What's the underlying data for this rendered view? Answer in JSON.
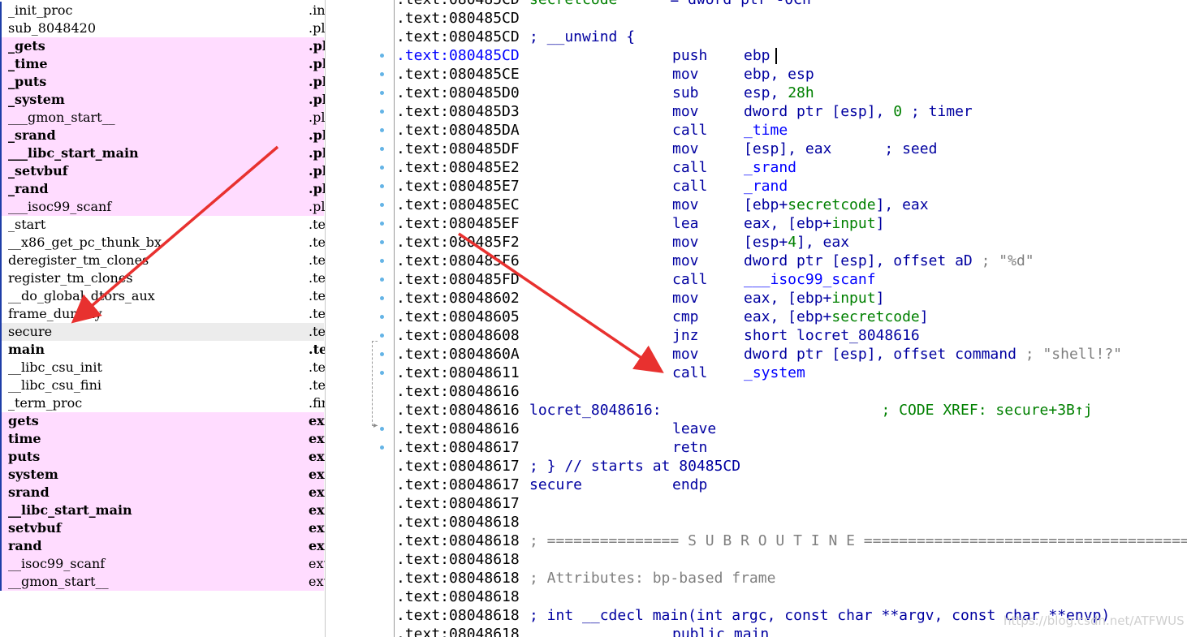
{
  "functions": [
    {
      "name": "_init_proc",
      "seg": ".ini",
      "lib": false,
      "bold": false,
      "sel": false
    },
    {
      "name": "sub_8048420",
      "seg": ".plt",
      "lib": false,
      "bold": false,
      "sel": false
    },
    {
      "name": "_gets",
      "seg": ".plt",
      "lib": true,
      "bold": true,
      "sel": false
    },
    {
      "name": "_time",
      "seg": ".plt",
      "lib": true,
      "bold": true,
      "sel": false
    },
    {
      "name": "_puts",
      "seg": ".plt",
      "lib": true,
      "bold": true,
      "sel": false
    },
    {
      "name": "_system",
      "seg": ".plt",
      "lib": true,
      "bold": true,
      "sel": false
    },
    {
      "name": "___gmon_start__",
      "seg": ".plt",
      "lib": true,
      "bold": false,
      "sel": false
    },
    {
      "name": "_srand",
      "seg": ".plt",
      "lib": true,
      "bold": true,
      "sel": false
    },
    {
      "name": "___libc_start_main",
      "seg": ".plt",
      "lib": true,
      "bold": true,
      "sel": false
    },
    {
      "name": "_setvbuf",
      "seg": ".plt",
      "lib": true,
      "bold": true,
      "sel": false
    },
    {
      "name": "_rand",
      "seg": ".plt",
      "lib": true,
      "bold": true,
      "sel": false
    },
    {
      "name": "___isoc99_scanf",
      "seg": ".plt",
      "lib": true,
      "bold": false,
      "sel": false
    },
    {
      "name": "_start",
      "seg": ".text",
      "lib": false,
      "bold": false,
      "sel": false
    },
    {
      "name": "__x86_get_pc_thunk_bx",
      "seg": ".text",
      "lib": false,
      "bold": false,
      "sel": false
    },
    {
      "name": "deregister_tm_clones",
      "seg": ".text",
      "lib": false,
      "bold": false,
      "sel": false
    },
    {
      "name": "register_tm_clones",
      "seg": ".text",
      "lib": false,
      "bold": false,
      "sel": false
    },
    {
      "name": "__do_global_dtors_aux",
      "seg": ".text",
      "lib": false,
      "bold": false,
      "sel": false
    },
    {
      "name": "frame_dummy",
      "seg": ".text",
      "lib": false,
      "bold": false,
      "sel": false
    },
    {
      "name": "secure",
      "seg": ".text",
      "lib": false,
      "bold": false,
      "sel": true
    },
    {
      "name": "main",
      "seg": ".text",
      "lib": false,
      "bold": true,
      "sel": false
    },
    {
      "name": "__libc_csu_init",
      "seg": ".text",
      "lib": false,
      "bold": false,
      "sel": false
    },
    {
      "name": "__libc_csu_fini",
      "seg": ".text",
      "lib": false,
      "bold": false,
      "sel": false
    },
    {
      "name": "_term_proc",
      "seg": ".fini",
      "lib": false,
      "bold": false,
      "sel": false
    },
    {
      "name": "gets",
      "seg": "extern",
      "lib": true,
      "bold": true,
      "sel": false
    },
    {
      "name": "time",
      "seg": "extern",
      "lib": true,
      "bold": true,
      "sel": false
    },
    {
      "name": "puts",
      "seg": "extern",
      "lib": true,
      "bold": true,
      "sel": false
    },
    {
      "name": "system",
      "seg": "extern",
      "lib": true,
      "bold": true,
      "sel": false
    },
    {
      "name": "srand",
      "seg": "extern",
      "lib": true,
      "bold": true,
      "sel": false
    },
    {
      "name": "__libc_start_main",
      "seg": "extern",
      "lib": true,
      "bold": true,
      "sel": false
    },
    {
      "name": "setvbuf",
      "seg": "extern",
      "lib": true,
      "bold": true,
      "sel": false
    },
    {
      "name": "rand",
      "seg": "extern",
      "lib": true,
      "bold": true,
      "sel": false
    },
    {
      "name": "__isoc99_scanf",
      "seg": "extern",
      "lib": true,
      "bold": false,
      "sel": false
    },
    {
      "name": "__gmon_start__",
      "seg": "extern",
      "lib": true,
      "bold": false,
      "sel": false
    }
  ],
  "disasm": [
    {
      "addr": ".text:080485CD",
      "label": [
        {
          "t": "secretcode",
          "c": "grn"
        },
        {
          "t": "      = dword ptr -0Ch",
          "c": "navy"
        }
      ]
    },
    {
      "addr": ".text:080485CD"
    },
    {
      "addr": ".text:080485CD",
      "label": [
        {
          "t": "; __unwind {",
          "c": "navy"
        }
      ]
    },
    {
      "addr": ".text:080485CD",
      "cur": true,
      "mn": "push",
      "op": [
        {
          "t": "ebp",
          "c": "navy"
        }
      ],
      "cursor": true
    },
    {
      "addr": ".text:080485CE",
      "mn": "mov",
      "op": [
        {
          "t": "ebp, esp",
          "c": "navy"
        }
      ]
    },
    {
      "addr": ".text:080485D0",
      "mn": "sub",
      "op": [
        {
          "t": "esp, ",
          "c": "navy"
        },
        {
          "t": "28h",
          "c": "grn"
        }
      ]
    },
    {
      "addr": ".text:080485D3",
      "mn": "mov",
      "op": [
        {
          "t": "dword ptr [esp], ",
          "c": "navy"
        },
        {
          "t": "0",
          "c": "grn"
        },
        {
          "t": " ; timer",
          "c": "navy"
        }
      ]
    },
    {
      "addr": ".text:080485DA",
      "mn": "call",
      "op": [
        {
          "t": "_time",
          "c": "blue"
        }
      ]
    },
    {
      "addr": ".text:080485DF",
      "mn": "mov",
      "op": [
        {
          "t": "[esp], eax      ; seed",
          "c": "navy"
        }
      ]
    },
    {
      "addr": ".text:080485E2",
      "mn": "call",
      "op": [
        {
          "t": "_srand",
          "c": "blue"
        }
      ]
    },
    {
      "addr": ".text:080485E7",
      "mn": "call",
      "op": [
        {
          "t": "_rand",
          "c": "blue"
        }
      ]
    },
    {
      "addr": ".text:080485EC",
      "mn": "mov",
      "op": [
        {
          "t": "[ebp+",
          "c": "navy"
        },
        {
          "t": "secretcode",
          "c": "grn"
        },
        {
          "t": "], eax",
          "c": "navy"
        }
      ]
    },
    {
      "addr": ".text:080485EF",
      "mn": "lea",
      "op": [
        {
          "t": "eax, [ebp+",
          "c": "navy"
        },
        {
          "t": "input",
          "c": "grn"
        },
        {
          "t": "]",
          "c": "navy"
        }
      ]
    },
    {
      "addr": ".text:080485F2",
      "mn": "mov",
      "op": [
        {
          "t": "[esp+",
          "c": "navy"
        },
        {
          "t": "4",
          "c": "grn"
        },
        {
          "t": "], eax",
          "c": "navy"
        }
      ]
    },
    {
      "addr": ".text:080485F6",
      "mn": "mov",
      "op": [
        {
          "t": "dword ptr [esp], offset aD ",
          "c": "navy"
        },
        {
          "t": "; \"%d\"",
          "c": "gray"
        }
      ]
    },
    {
      "addr": ".text:080485FD",
      "mn": "call",
      "op": [
        {
          "t": "___isoc99_scanf",
          "c": "blue"
        }
      ]
    },
    {
      "addr": ".text:08048602",
      "mn": "mov",
      "op": [
        {
          "t": "eax, [ebp+",
          "c": "navy"
        },
        {
          "t": "input",
          "c": "grn"
        },
        {
          "t": "]",
          "c": "navy"
        }
      ]
    },
    {
      "addr": ".text:08048605",
      "mn": "cmp",
      "op": [
        {
          "t": "eax, [ebp+",
          "c": "navy"
        },
        {
          "t": "secretcode",
          "c": "grn"
        },
        {
          "t": "]",
          "c": "navy"
        }
      ]
    },
    {
      "addr": ".text:08048608",
      "mn": "jnz",
      "op": [
        {
          "t": "short locret_8048616",
          "c": "navy"
        }
      ]
    },
    {
      "addr": ".text:0804860A",
      "mn": "mov",
      "op": [
        {
          "t": "dword ptr [esp], offset command ",
          "c": "navy"
        },
        {
          "t": "; \"shell!?\"",
          "c": "gray"
        }
      ]
    },
    {
      "addr": ".text:08048611",
      "mn": "call",
      "op": [
        {
          "t": "_system",
          "c": "blue"
        }
      ]
    },
    {
      "addr": ".text:08048616"
    },
    {
      "addr": ".text:08048616",
      "label": [
        {
          "t": "locret_8048616:                         ",
          "c": "navy"
        },
        {
          "t": "; CODE XREF: secure+3B↑j",
          "c": "grn"
        }
      ]
    },
    {
      "addr": ".text:08048616",
      "mn": "leave"
    },
    {
      "addr": ".text:08048617",
      "mn": "retn"
    },
    {
      "addr": ".text:08048617",
      "label": [
        {
          "t": "; } // starts at 80485CD",
          "c": "navy"
        }
      ]
    },
    {
      "addr": ".text:08048617",
      "label": [
        {
          "t": "secure          ",
          "c": "navy"
        }
      ],
      "mn": "endp"
    },
    {
      "addr": ".text:08048617"
    },
    {
      "addr": ".text:08048618"
    },
    {
      "addr": ".text:08048618",
      "label": [
        {
          "t": "; =============== S U B R O U T I N E =======================================",
          "c": "gray"
        }
      ]
    },
    {
      "addr": ".text:08048618"
    },
    {
      "addr": ".text:08048618",
      "label": [
        {
          "t": "; Attributes: bp-based frame",
          "c": "gray"
        }
      ]
    },
    {
      "addr": ".text:08048618"
    },
    {
      "addr": ".text:08048618",
      "label": [
        {
          "t": "; int __cdecl main(int argc, const char **argv, const char **envp)",
          "c": "navy"
        }
      ]
    },
    {
      "addr": ".text:08048618",
      "mn": "public main"
    }
  ],
  "watermark": "https://blog.csdn.net/ATFWUS",
  "colors": {
    "lib_bg": "#ffdcff",
    "selected_bg": "#ececec",
    "arrow": "#e8312f",
    "gutter_dot": "#64b4e6"
  }
}
